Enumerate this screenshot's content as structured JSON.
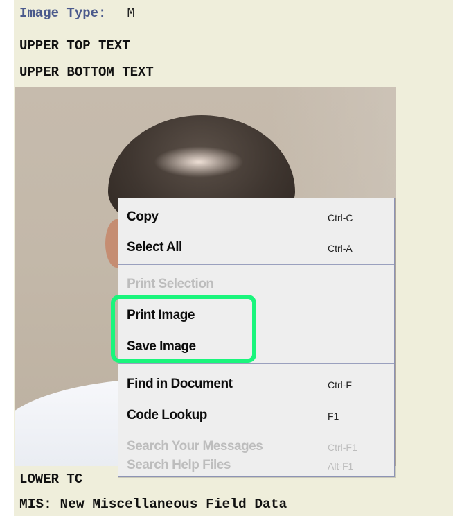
{
  "header": {
    "image_type_label": "Image Type:",
    "image_type_value": "M",
    "upper_top_text": "UPPER TOP TEXT",
    "upper_bottom_text": "UPPER BOTTOM TEXT"
  },
  "footer": {
    "lower_text_visible": "LOWER TC",
    "mis_text": "MIS: New Miscellaneous Field Data"
  },
  "photo": {
    "subject": "portrait-photo"
  },
  "context_menu": {
    "items": [
      {
        "label": "Copy",
        "shortcut": "Ctrl-C",
        "enabled": true
      },
      {
        "label": "Select All",
        "shortcut": "Ctrl-A",
        "enabled": true
      },
      {
        "label": "Print Selection",
        "shortcut": "",
        "enabled": false
      },
      {
        "label": "Print Image",
        "shortcut": "",
        "enabled": true
      },
      {
        "label": "Save Image",
        "shortcut": "",
        "enabled": true
      },
      {
        "label": "Find in Document",
        "shortcut": "Ctrl-F",
        "enabled": true
      },
      {
        "label": "Code Lookup",
        "shortcut": "F1",
        "enabled": true
      },
      {
        "label": "Search Your Messages",
        "shortcut": "Ctrl-F1",
        "enabled": false
      },
      {
        "label": "Search Help Files",
        "shortcut": "Alt-F1",
        "enabled": false
      }
    ]
  },
  "colors": {
    "panel_background": "#efeedb",
    "label_blue": "#4b5a8c",
    "menu_background": "#eeeeee",
    "menu_border": "#8d93b4",
    "highlight_green": "#1af57c",
    "disabled_text": "#bdbdbd"
  }
}
